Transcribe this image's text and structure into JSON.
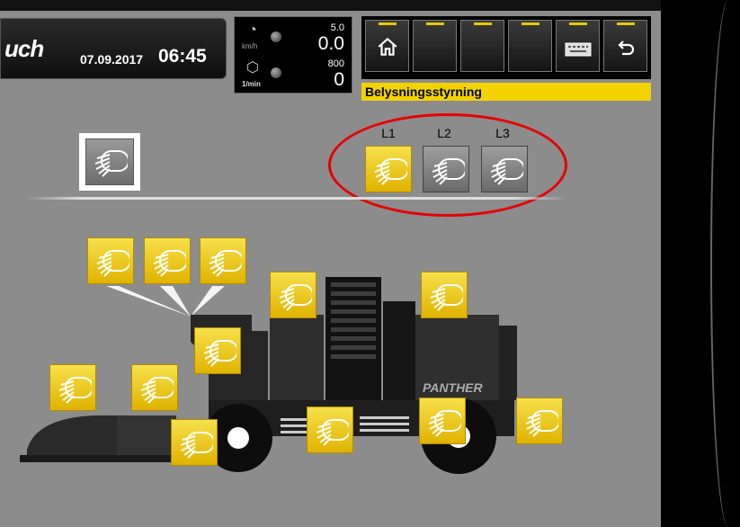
{
  "header": {
    "logo": "uch",
    "date": "07.09.2017",
    "time": "06:45"
  },
  "gauges": {
    "speed": {
      "unit": "km/h",
      "max": "5.0",
      "value": "0.0"
    },
    "rpm": {
      "unit": "1/min",
      "max": "800",
      "value": "0"
    }
  },
  "nav": {
    "buttons": [
      "home",
      "",
      "",
      "",
      "",
      "keyboard",
      "back"
    ]
  },
  "page_title": "Belysningsstyrning",
  "light_groups": {
    "labels": [
      "L1",
      "L2",
      "L3"
    ],
    "states": [
      "on",
      "off",
      "off"
    ]
  },
  "master_light": {
    "state": "off"
  },
  "machine": {
    "brand_label": "PANTHER",
    "lights_state": "on"
  },
  "colors": {
    "accent": "#f2d200",
    "light_on": "#f0c400",
    "light_off": "#808080",
    "highlight_ring": "#e60000"
  }
}
